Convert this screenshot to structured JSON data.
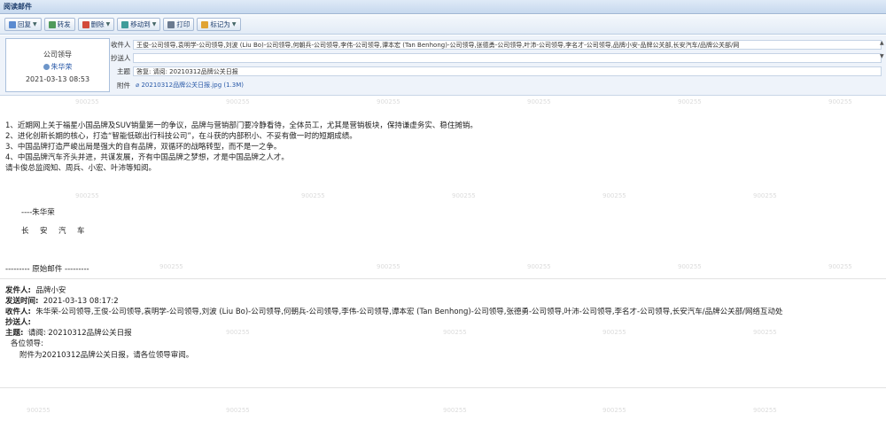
{
  "window": {
    "title": "阅读邮件"
  },
  "toolbar": {
    "reply": "回复",
    "forward": "转发",
    "delete": "删除",
    "move": "移动到",
    "print": "打印",
    "mark": "标记为"
  },
  "header": {
    "sender_role": "公司领导",
    "sender_name": "朱华荣",
    "sender_date": "2021-03-13 08:53",
    "to_label": "收件人",
    "to_value": "王俊-公司领导,袁明学-公司领导,刘波 (Liu Bo)-公司领导,何朝兵-公司领导,李伟-公司领导,谭本宏 (Tan Benhong)-公司领导,张德勇-公司领导,叶沛-公司领导,李名才-公司领导,品牌小安-品牌公关部,长安汽车/品牌公关部/网",
    "cc_label": "抄送人",
    "cc_value": "",
    "subject_label": "主题",
    "subject_value": "答复: 请阅: 20210312品牌公关日报",
    "attach_label": "附件",
    "attach_value": "20210312品牌公关日报.jpg (1.3M)"
  },
  "body": {
    "lines": [
      "1、近期网上关于福星小国品牌及SUV销量第一的争议，品牌与营销部门要冷静看待，全体员工，尤其是营销板块，保持谦虚务实、稳住摊销。",
      "2、进化创新长期的核心，打造“智能低碳出行科技公司”，在斗获的内部积小、不妥有傲一时的短期成绩。",
      "3、中国品牌打造严峻出局是强大的自有品牌，双循环的战略转型，而不是一之争。",
      "4、中国品牌汽车齐头并进，共谋发展，齐有中国品牌之梦想，才是中国品牌之人才。",
      "请卡俊总监阅知、周兵、小宏、叶沛等知阅。"
    ],
    "signature_dash": "----朱华荣",
    "signature_company": "长　安　汽　车",
    "original_sep": "--------- 原始邮件 ---------",
    "orig_from_label": "发件人:",
    "orig_from": "品牌小安",
    "orig_time_label": "发送时间:",
    "orig_time": "2021-03-13 08:17:2",
    "orig_to_label": "收件人:",
    "orig_to": "朱华荣-公司领导,王俊-公司领导,袁明学-公司领导,刘波 (Liu Bo)-公司领导,何朝兵-公司领导,李伟-公司领导,谭本宏 (Tan Benhong)-公司领导,张德勇-公司领导,叶沛-公司领导,李名才-公司领导,长安汽车/品牌公关部/网络互动处",
    "orig_cc_label": "抄送人:",
    "orig_cc": "",
    "orig_subject_label": "主题:",
    "orig_subject": "请阅: 20210312品牌公关日报",
    "orig_greeting": "各位领导:",
    "orig_content": "附件为20210312品牌公关日报，请各位领导审阅。",
    "watermark": "900255"
  },
  "colors": {
    "toolbar_text": "#1f3f6e",
    "link": "#2a5aa8",
    "header_bg": "#eef3fa"
  }
}
